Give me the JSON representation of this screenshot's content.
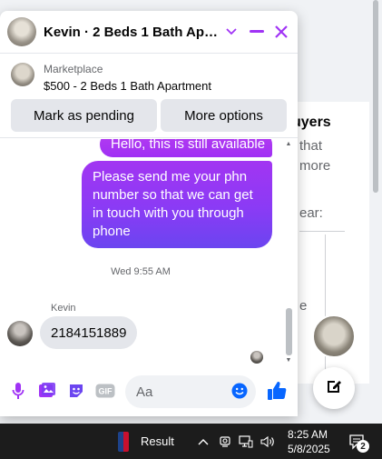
{
  "background": {
    "heading": "uyers",
    "lines": [
      "that",
      "more",
      "ear:",
      "e"
    ]
  },
  "chat": {
    "title": "Kevin · 2 Beds 1 Bath Apart…",
    "listing": {
      "label": "Marketplace",
      "description": "$500 - 2 Beds 1 Bath Apartment"
    },
    "actions": {
      "mark_pending": "Mark as pending",
      "more_options": "More options"
    },
    "messages": [
      {
        "from": "me",
        "text": "Hello, this is still available"
      },
      {
        "from": "me",
        "text": "Please send me your phn number so that we can get in touch with you through phone"
      }
    ],
    "timestamp": "Wed 9:55 AM",
    "sender_name": "Kevin",
    "reply": "2184151889",
    "composer": {
      "placeholder": "Aa"
    }
  },
  "taskbar": {
    "result_label": "Result",
    "time": "8:25 AM",
    "date": "5/8/2025",
    "notification_count": "2"
  },
  "colors": {
    "accent_purple": "#a033f5",
    "messenger_blue": "#0866ff",
    "taskbar": "#1c1c1c"
  },
  "icons": {
    "header": [
      "avatar",
      "chevron-down-icon",
      "minimize-icon",
      "close-icon"
    ],
    "composer": [
      "mic-icon",
      "photo-icon",
      "sticker-icon",
      "gif-icon",
      "emoji-icon",
      "like-icon"
    ],
    "tray": [
      "chevron-up-icon",
      "camera-icon",
      "network-icon",
      "volume-icon",
      "notification-icon"
    ]
  }
}
